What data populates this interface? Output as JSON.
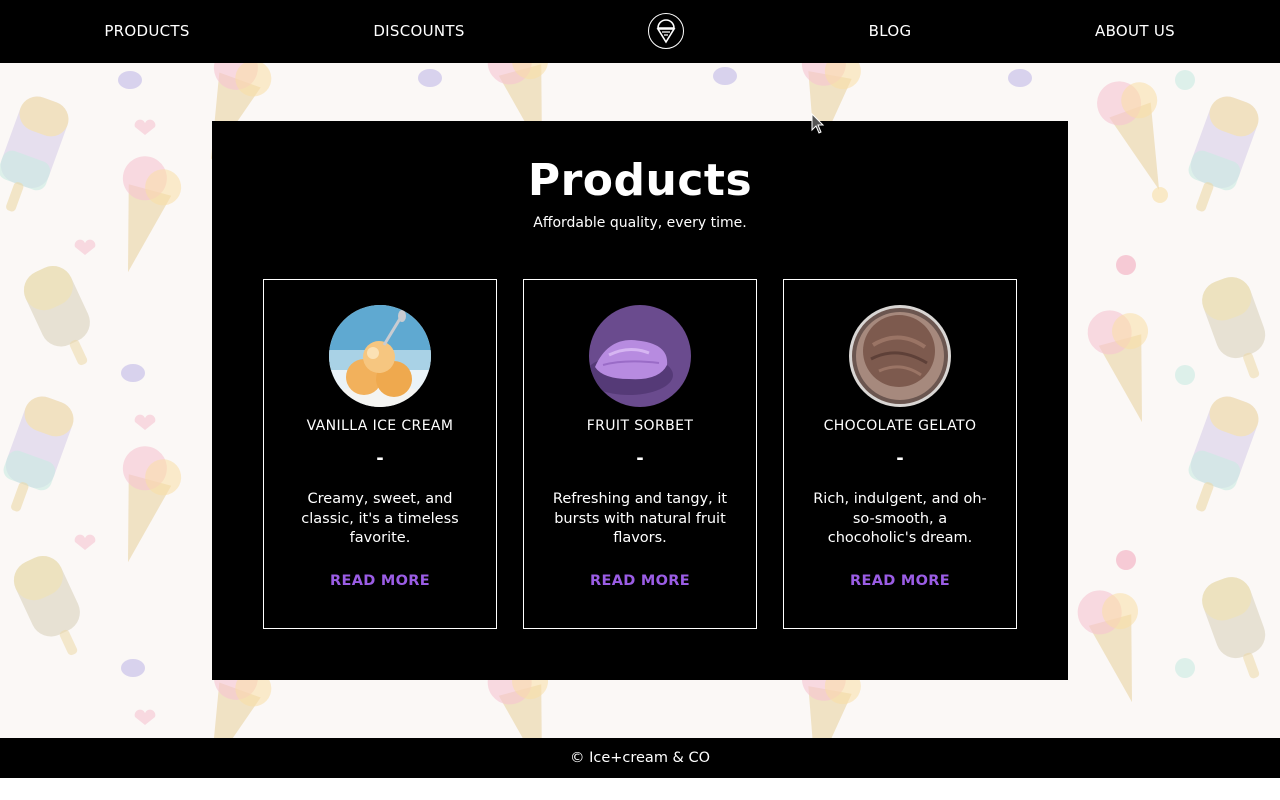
{
  "nav": {
    "items": [
      {
        "label": "PRODUCTS"
      },
      {
        "label": "DISCOUNTS"
      },
      {
        "label": "BLOG"
      },
      {
        "label": "ABOUT US"
      }
    ],
    "logo_icon": "ice-cream-cone-icon"
  },
  "main": {
    "title": "Products",
    "subtitle": "Affordable quality, every time.",
    "cards": [
      {
        "name": "VANILLA ICE CREAM",
        "dash": "-",
        "description": "Creamy, sweet, and classic, it's a timeless favorite.",
        "link": "READ MORE",
        "image_icon": "vanilla-ice-cream-photo"
      },
      {
        "name": "FRUIT SORBET",
        "dash": "-",
        "description": "Refreshing and tangy, it bursts with natural fruit flavors.",
        "link": "READ MORE",
        "image_icon": "fruit-sorbet-photo"
      },
      {
        "name": "CHOCOLATE GELATO",
        "dash": "-",
        "description": "Rich, indulgent, and oh-so-smooth, a chocoholic's dream.",
        "link": "READ MORE",
        "image_icon": "chocolate-gelato-photo"
      }
    ]
  },
  "footer": {
    "text": "© Ice+cream & CO"
  },
  "colors": {
    "accent": "#9b5de5",
    "nav_bg": "#000000",
    "panel_bg": "#000000"
  }
}
